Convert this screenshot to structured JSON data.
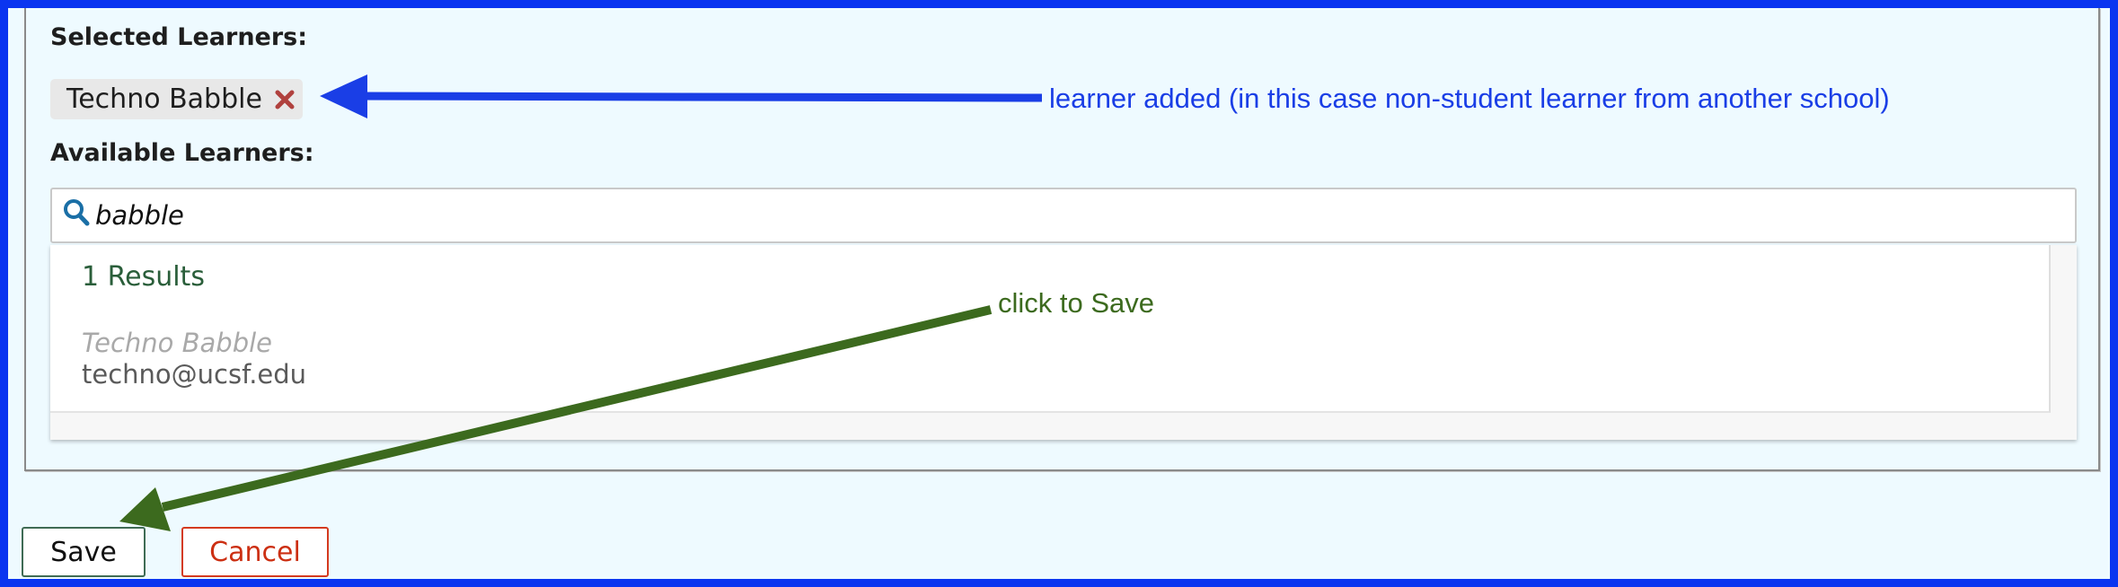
{
  "selected": {
    "heading": "Selected Learners:",
    "chips": [
      {
        "label": "Techno Babble",
        "remove_icon": "close-icon"
      }
    ]
  },
  "available": {
    "heading": "Available Learners:",
    "search": {
      "value": "babble",
      "icon": "search-icon"
    },
    "results": {
      "count_label": "1 Results",
      "items": [
        {
          "name": "Techno Babble",
          "email": "techno@ucsf.edu"
        }
      ]
    }
  },
  "actions": {
    "save_label": "Save",
    "cancel_label": "Cancel"
  },
  "annotations": {
    "learner_added": "learner added (in this case non-student learner from another school)",
    "click_to_save": "click to Save"
  },
  "colors": {
    "frame": "#0a35f0",
    "background": "#eefaff",
    "blue_annotation": "#1a3ee6",
    "green_annotation": "#3c6a1e",
    "remove_icon": "#b0413e",
    "search_icon": "#1a6fa6",
    "cancel": "#cc2f12"
  }
}
